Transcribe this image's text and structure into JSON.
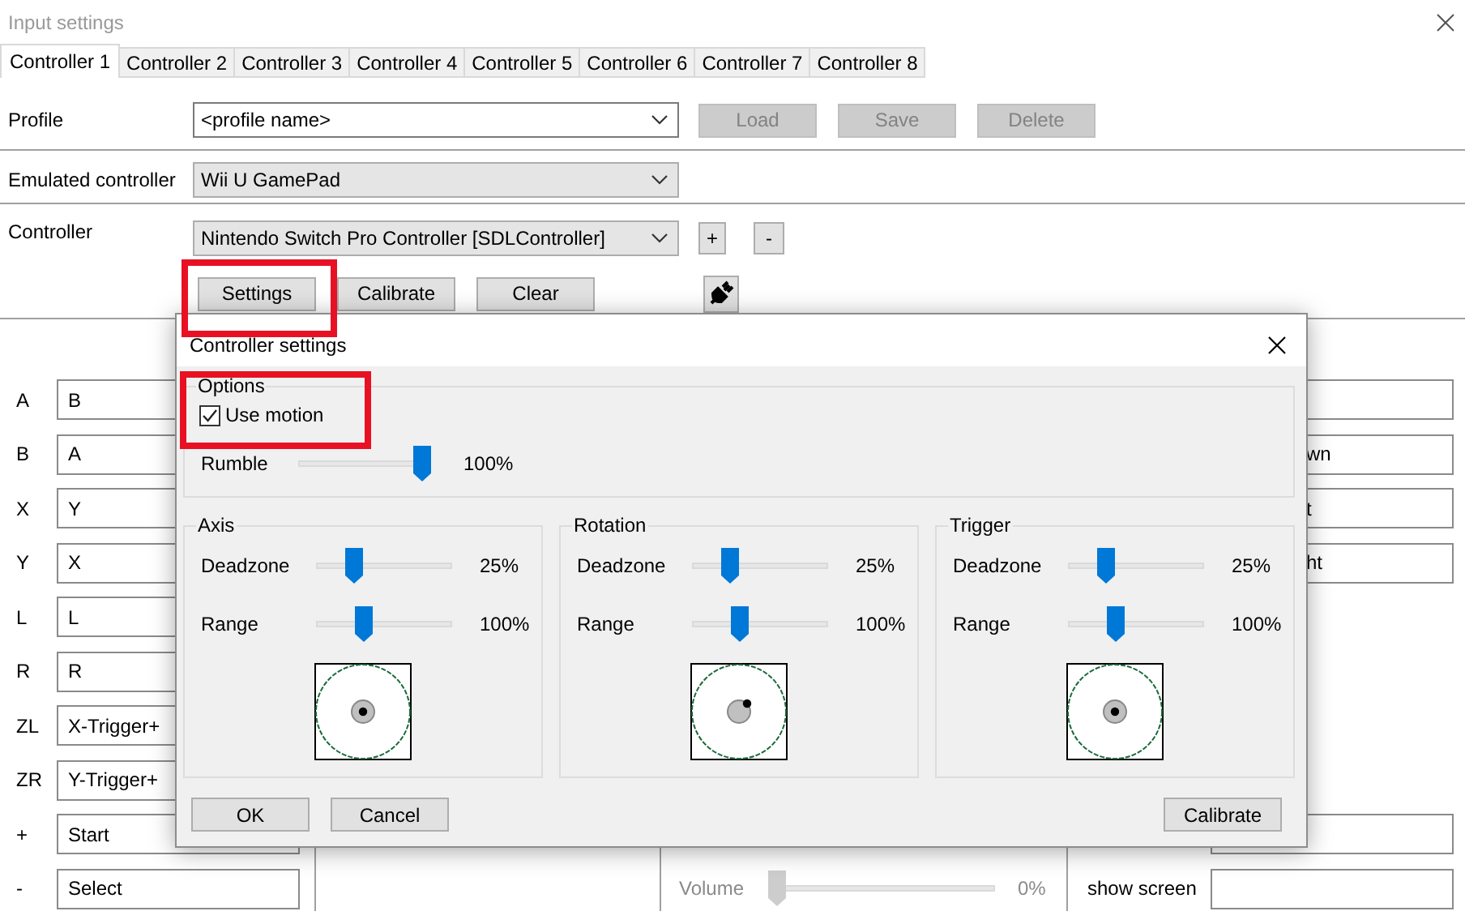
{
  "window": {
    "title": "Input settings"
  },
  "tabs": [
    {
      "label": "Controller 1",
      "selected": true
    },
    {
      "label": "Controller 2",
      "selected": false
    },
    {
      "label": "Controller 3",
      "selected": false
    },
    {
      "label": "Controller 4",
      "selected": false
    },
    {
      "label": "Controller 5",
      "selected": false
    },
    {
      "label": "Controller 6",
      "selected": false
    },
    {
      "label": "Controller 7",
      "selected": false
    },
    {
      "label": "Controller 8",
      "selected": false
    }
  ],
  "profile": {
    "label": "Profile",
    "value": "<profile name>",
    "buttons": [
      {
        "label": "Load",
        "disabled": true
      },
      {
        "label": "Save",
        "disabled": true
      },
      {
        "label": "Delete",
        "disabled": true
      }
    ]
  },
  "emulated_controller": {
    "label": "Emulated controller",
    "value": "Wii U GamePad"
  },
  "controller": {
    "label": "Controller",
    "value": "Nintendo Switch Pro Controller [SDLController]",
    "add": "+",
    "remove": "-",
    "buttons": [
      {
        "label": "Settings"
      },
      {
        "label": "Calibrate"
      },
      {
        "label": "Clear"
      }
    ]
  },
  "mappings": [
    {
      "label": "A",
      "value": "B"
    },
    {
      "label": "B",
      "value": "A"
    },
    {
      "label": "X",
      "value": "Y"
    },
    {
      "label": "Y",
      "value": "X"
    },
    {
      "label": "L",
      "value": "L"
    },
    {
      "label": "R",
      "value": "R"
    },
    {
      "label": "ZL",
      "value": "X-Trigger+"
    },
    {
      "label": "ZR",
      "value": "Y-Trigger+"
    },
    {
      "label": "+",
      "value": "Start"
    },
    {
      "label": "-",
      "value": "Select"
    }
  ],
  "right_mappings": [
    {
      "kind": "field"
    },
    {
      "kind": "field",
      "value": "wn"
    },
    {
      "kind": "field",
      "value": "t"
    },
    {
      "kind": "field",
      "value": "ht"
    },
    {
      "kind": "empty"
    },
    {
      "kind": "empty"
    },
    {
      "kind": "empty"
    },
    {
      "kind": "empty"
    },
    {
      "kind": "field"
    },
    {
      "kind": "field",
      "label": "show screen"
    }
  ],
  "volume": {
    "label": "Volume",
    "level": 0,
    "reading": "0%",
    "disabled": true
  },
  "dialog": {
    "title": "Controller settings",
    "options": {
      "title": "Options",
      "use_motion": {
        "label": "Use motion",
        "checked": true
      },
      "rumble": {
        "label": "Rumble",
        "level": 1,
        "reading": "100%"
      }
    },
    "groups": [
      {
        "title": "Axis",
        "stick_moved": false,
        "sliders": [
          {
            "label": "Deadzone",
            "level": 0.25,
            "reading": "25%"
          },
          {
            "label": "Range",
            "level": 0.33,
            "reading": "100%"
          }
        ]
      },
      {
        "title": "Rotation",
        "stick_moved": true,
        "sliders": [
          {
            "label": "Deadzone",
            "level": 0.25,
            "reading": "25%"
          },
          {
            "label": "Range",
            "level": 0.33,
            "reading": "100%"
          }
        ]
      },
      {
        "title": "Trigger",
        "stick_moved": false,
        "sliders": [
          {
            "label": "Deadzone",
            "level": 0.25,
            "reading": "25%"
          },
          {
            "label": "Range",
            "level": 0.33,
            "reading": "100%"
          }
        ]
      }
    ],
    "buttons": [
      {
        "label": "OK"
      },
      {
        "label": "Cancel"
      }
    ],
    "calibrate": {
      "label": "Calibrate"
    }
  }
}
